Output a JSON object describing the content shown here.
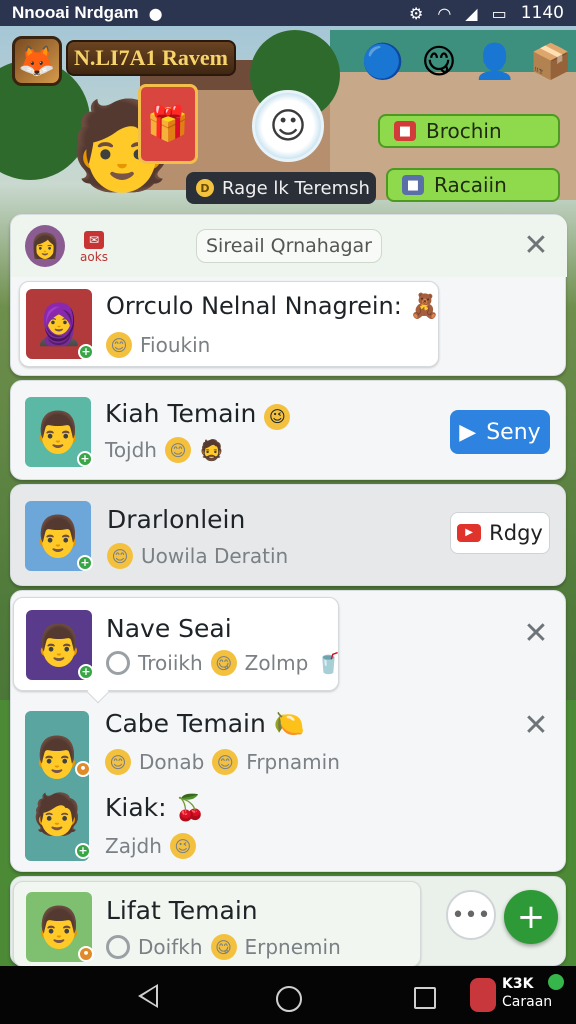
{
  "status_bar": {
    "app_title": "Nnooai Nrdgam",
    "time": "1140"
  },
  "header": {
    "player_name": "N.LI7A1 Ravem",
    "timer_face": "☺",
    "status_chip": "Rage lk Teremsh",
    "coin_glyph": "D",
    "buttons": [
      {
        "label": "Brochin"
      },
      {
        "label": "Racaiin"
      }
    ],
    "icons": [
      "blue-blob-icon",
      "yellow-blob-icon",
      "avatar-coin-icon",
      "gift-box-icon"
    ]
  },
  "chat": {
    "search_placeholder": "Sireail Qrnahagar",
    "badge_text": "aoks",
    "contacts": [
      {
        "name": "Orrculo Nelnal Nnagrein:",
        "status": "Fioukin"
      },
      {
        "name": "Kiah Temain",
        "status": "Tojdh",
        "action": "Seny"
      },
      {
        "name": "Drarlonlein",
        "status": "Uowila Deratin",
        "action": "Rdgy"
      },
      {
        "name": "Nave Seai",
        "status": "Troiikh",
        "status2": "Zolmp"
      },
      {
        "name": "Cabe Temain",
        "status": "Donab",
        "status2": "Frpnamin"
      },
      {
        "name": "Kiak:",
        "status": "Zajdh"
      },
      {
        "name": "Lifat Temain",
        "status": "Doifkh",
        "status2": "Erpnemin"
      }
    ],
    "more_label": "•••",
    "fab_label": "+"
  },
  "navbar": {
    "app_name_top": "K3K",
    "app_name_bottom": "Caraan"
  },
  "colors": {
    "accent_green": "#8fd94d",
    "send_blue": "#2d83df",
    "fab_green": "#2e9a37",
    "status_bar": "#2b3550"
  }
}
